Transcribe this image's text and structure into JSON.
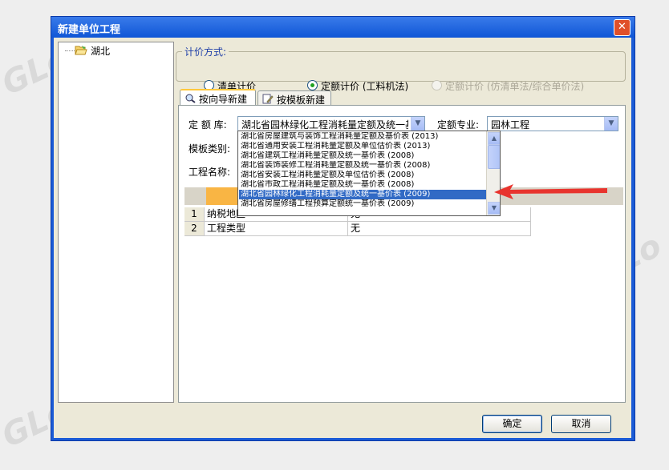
{
  "window": {
    "title": "新建单位工程",
    "close_symbol": "✕"
  },
  "tree": {
    "items": [
      {
        "label": "湖北"
      }
    ]
  },
  "pricing": {
    "group_label": "计价方式:",
    "options": [
      {
        "label": "清单计价",
        "checked": false,
        "enabled": true
      },
      {
        "label": "定额计价 (工料机法)",
        "checked": true,
        "enabled": true
      },
      {
        "label": "定额计价 (仿清单法/综合单价法)",
        "checked": false,
        "enabled": false
      }
    ]
  },
  "tabs": [
    {
      "label": "按向导新建",
      "active": true,
      "icon": "wizard-icon"
    },
    {
      "label": "按模板新建",
      "active": false,
      "icon": "template-icon"
    }
  ],
  "form": {
    "quota_lib_label": "定 额 库:",
    "quota_lib_value": "湖北省园林绿化工程消耗量定额及统一基价表 (2009)",
    "specialty_label": "定额专业:",
    "specialty_value": "园林工程",
    "template_type_label": "模板类别:",
    "project_name_label": "工程名称:"
  },
  "dropdown": {
    "options": [
      "湖北省房屋建筑与装饰工程消耗量定额及基价表 (2013)",
      "湖北省通用安装工程消耗量定额及单位估价表 (2013)",
      "湖北省建筑工程消耗量定额及统一基价表 (2008)",
      "湖北省装饰装修工程消耗量定额及统一基价表 (2008)",
      "湖北省安装工程消耗量定额及单位估价表 (2008)",
      "湖北省市政工程消耗量定额及统一基价表 (2008)",
      "湖北省园林绿化工程消耗量定额及统一基价表 (2009)",
      "湖北省房屋修缮工程预算定额统一基价表 (2009)"
    ],
    "selected_index": 6
  },
  "grid": {
    "rows": [
      {
        "num": "1",
        "name": "纳税地区",
        "value": "无"
      },
      {
        "num": "2",
        "name": "工程类型",
        "value": "无"
      }
    ]
  },
  "buttons": {
    "ok": "确定",
    "cancel": "取消"
  },
  "colors": {
    "title_bar": "#0f56d6",
    "selection": "#316ac5",
    "arrow": "#e8342e",
    "header_highlight": "#f9b544"
  }
}
